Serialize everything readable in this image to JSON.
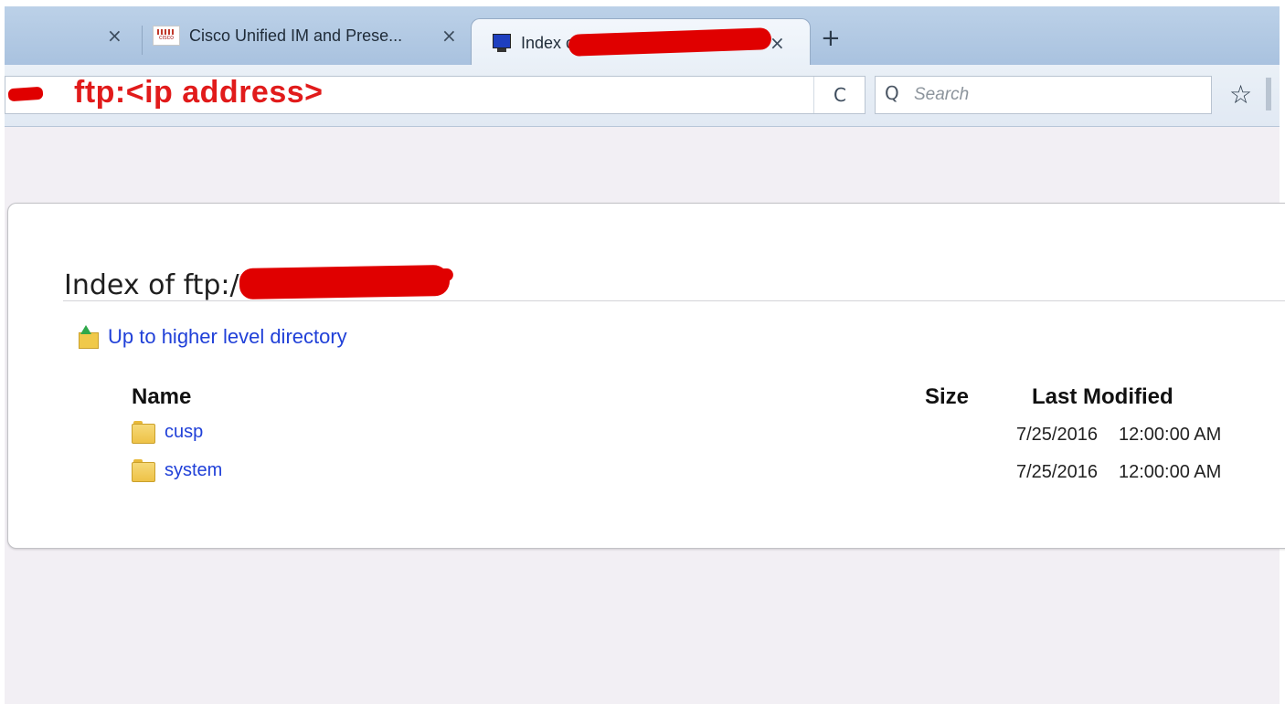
{
  "browser": {
    "tabs": [
      {
        "title": "",
        "close": "×"
      },
      {
        "title": "Cisco Unified IM and Prese...",
        "icon": "cisco-icon",
        "icon_text": "cisco",
        "close": "×"
      },
      {
        "title": "Index of",
        "icon": "monitor-icon",
        "close": "×",
        "active": true
      }
    ],
    "new_tab": "+",
    "url_annotation": "ftp:<ip address>",
    "reload": "C",
    "search_placeholder": "Search",
    "search_icon": "Q",
    "bookmark_star": "☆"
  },
  "page": {
    "heading": "Index of ftp:/",
    "up_link": "Up to higher level directory",
    "columns": {
      "name": "Name",
      "size": "Size",
      "modified": "Last Modified"
    },
    "entries": [
      {
        "name": "cusp",
        "size": "",
        "date": "7/25/2016",
        "time": "12:00:00 AM"
      },
      {
        "name": "system",
        "size": "",
        "date": "7/25/2016",
        "time": "12:00:00 AM"
      }
    ]
  },
  "colors": {
    "link": "#2040d8",
    "redaction": "#e00000",
    "annotation": "#e11b1b",
    "background": "#f2eff4"
  }
}
